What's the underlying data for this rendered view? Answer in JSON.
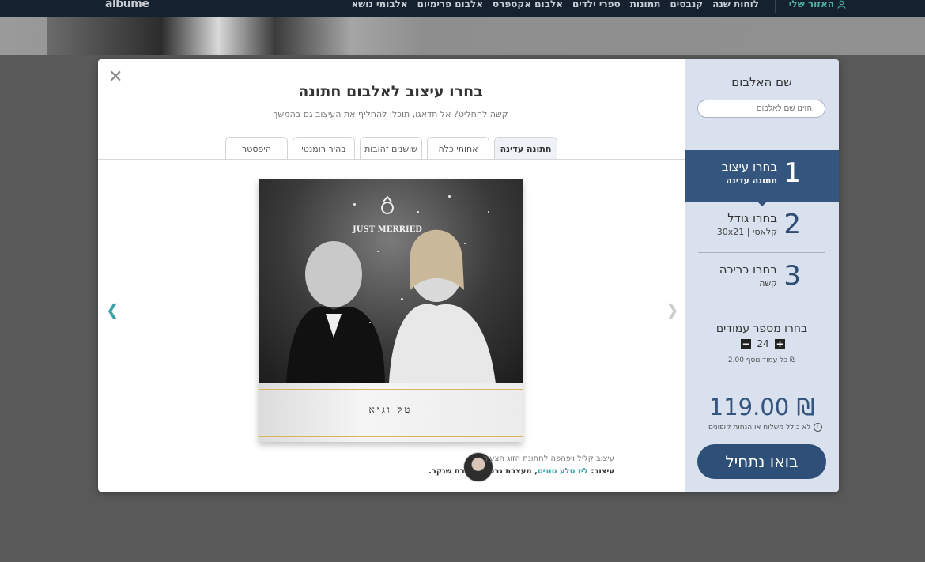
{
  "topbar": {
    "logo": "albume",
    "nav": [
      "לוחות שנה",
      "קנבסים",
      "תמונות",
      "ספרי ילדים",
      "אלבום אקספרס",
      "אלבום פרימיום",
      "אלבומי נושא"
    ],
    "account": "האזור שלי",
    "nav_color": "#c9ced6",
    "account_color": "#4fb1a4"
  },
  "modal": {
    "close_icon": "close-icon",
    "title": "בחרו עיצוב לאלבום חתונה",
    "subtitle": "קשה להחליט? אל תדאגו, תוכלו להחליף את העיצוב גם בהמשך",
    "tabs": [
      {
        "label": "חתונה עדינה",
        "active": true
      },
      {
        "label": "אחותי כלה",
        "active": false
      },
      {
        "label": "שושנים זהובות",
        "active": false
      },
      {
        "label": "בהיר רומנטי",
        "active": false
      },
      {
        "label": "היפסטר",
        "active": false
      }
    ],
    "album": {
      "photo_text": "JUST MERRIED",
      "names": "טל וגיא",
      "accent": "#d9b45c"
    },
    "credit": {
      "line1": "עיצוב קליל ויפהפה לחתונת הזוג הצעיר",
      "prefix": "עיצוב: ",
      "designer": "ליז סלע טוניס",
      "suffix": ", מעצבת גרפית, בוגרת שנקר."
    }
  },
  "sidebar": {
    "album_name_label": "שם האלבום",
    "album_name_placeholder": "הזינו שם לאלבום",
    "steps": [
      {
        "num": "1",
        "title": "בחרו עיצוב",
        "sub": "חתונה עדינה",
        "active": true
      },
      {
        "num": "2",
        "title": "בחרו גודל",
        "sub": "30x21 | קלאסי",
        "active": false
      },
      {
        "num": "3",
        "title": "בחרו כריכה",
        "sub": "קשה",
        "active": false
      }
    ],
    "pages": {
      "label": "בחרו מספר עמודים",
      "value": "24",
      "extra": "כל עמוד נוסף 2.00 ₪"
    },
    "price": "119.00 ₪",
    "coupon_note": "לא כולל משלוח או הנחות קופונים",
    "cta": "בואו נתחיל",
    "accent": "#33557e"
  }
}
